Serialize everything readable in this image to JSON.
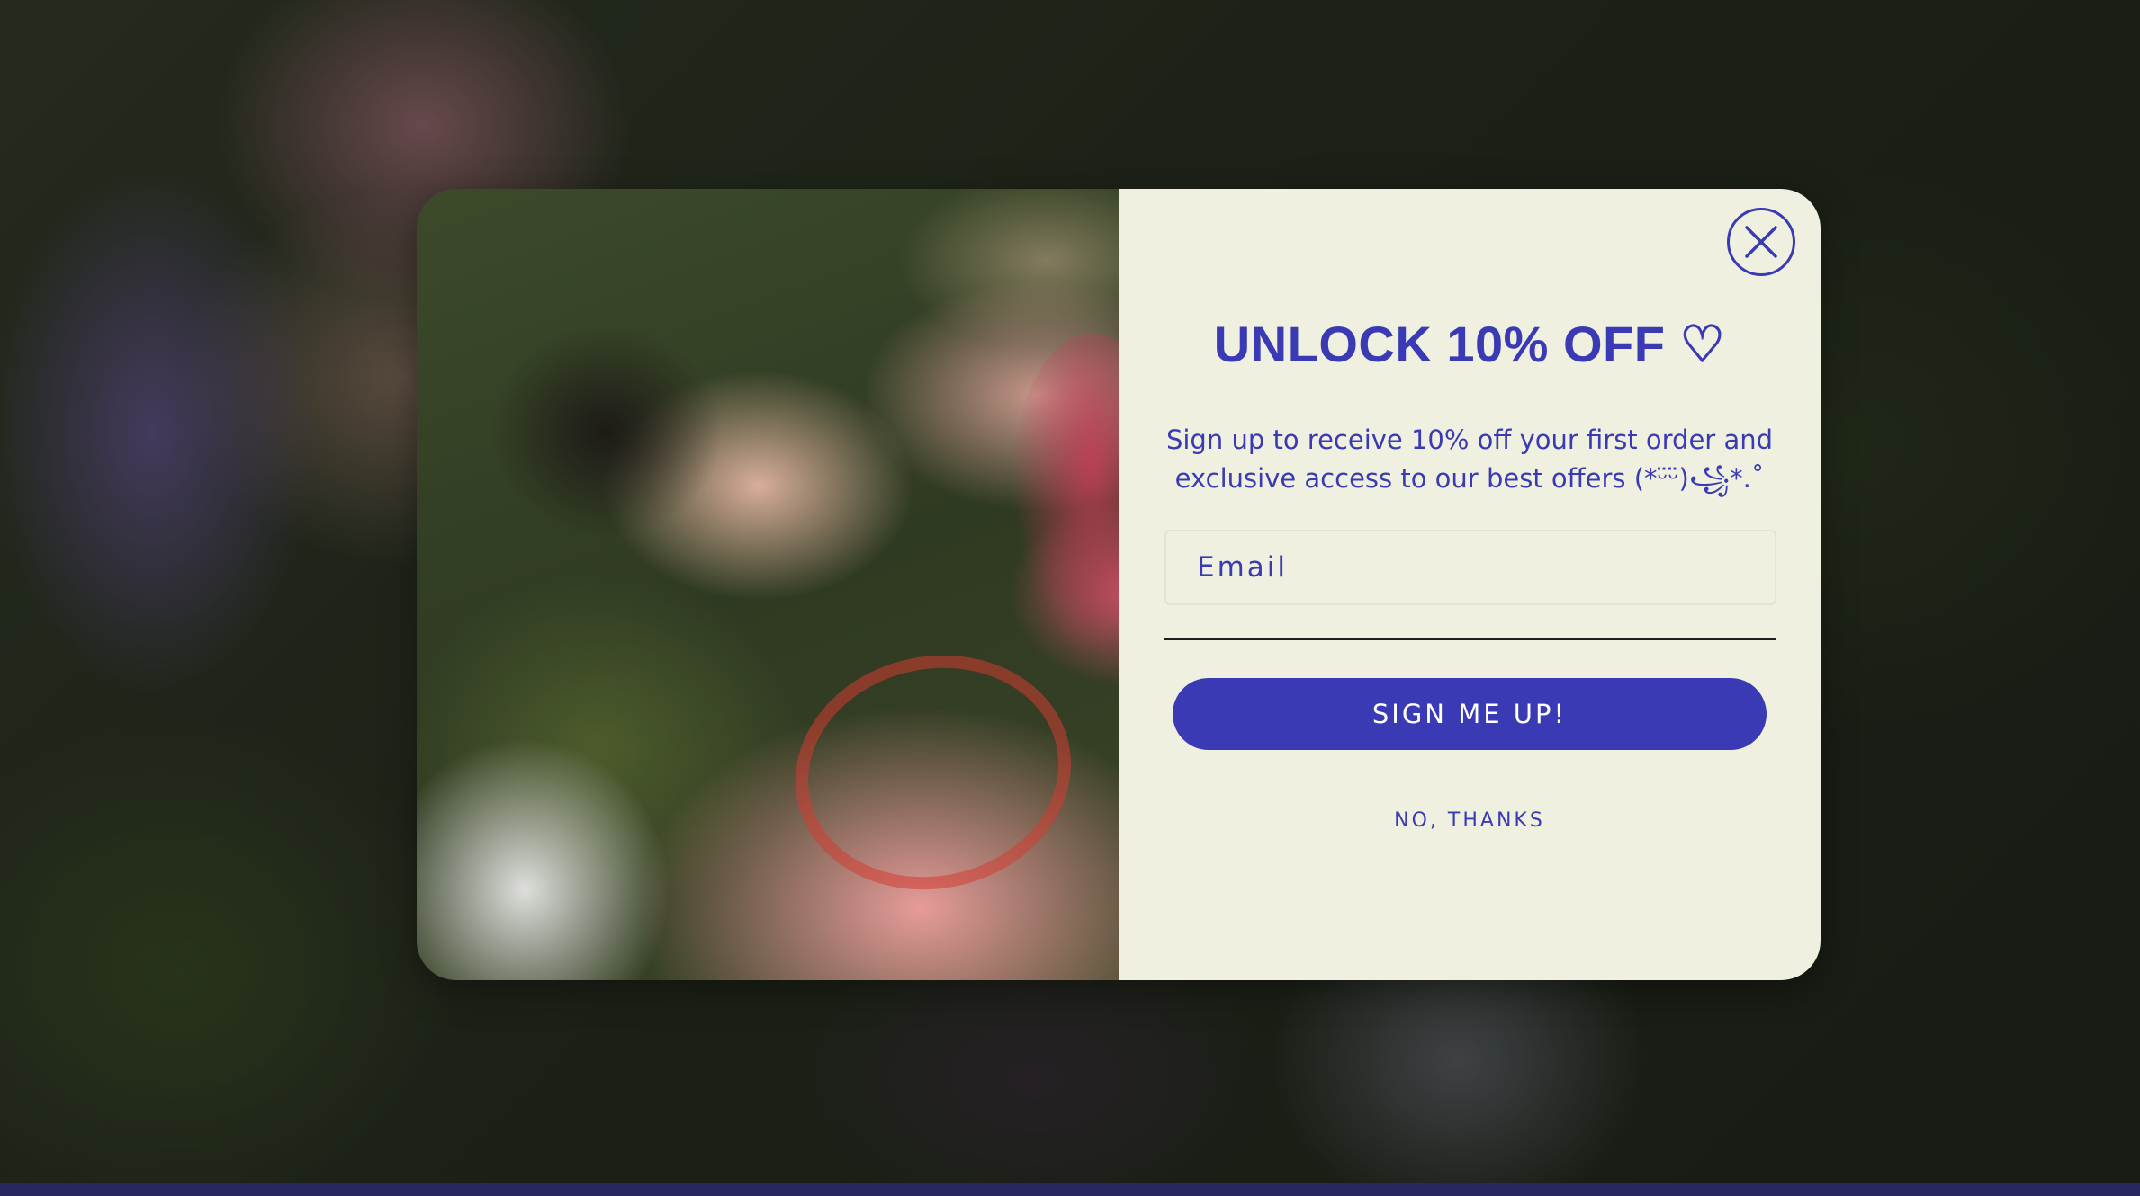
{
  "popup": {
    "headline": "UNLOCK 10% OFF ♡",
    "subtext": "Sign up to receive 10% off your first order and exclusive access to our best offers (*ᵕ̈ᵕ̈)꧁*.˚",
    "email_placeholder": "Email",
    "email_value": "",
    "signup_label": "SIGN ME UP!",
    "decline_label": "NO, THANKS",
    "close_icon": "close-x-icon"
  },
  "colors": {
    "accent": "#3a3bb4",
    "panel_background": "#eff0e0",
    "footer_bar": "#28275e"
  }
}
